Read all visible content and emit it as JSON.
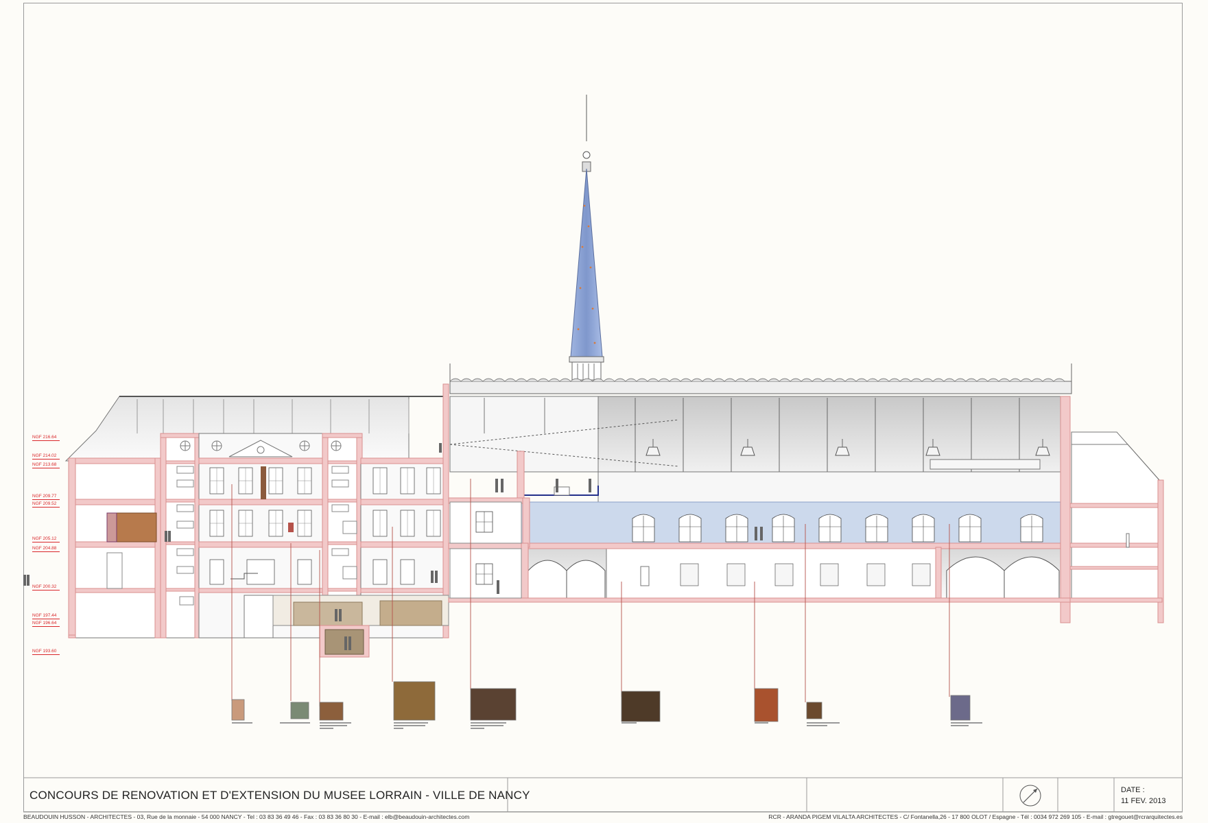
{
  "title_block": {
    "project_title": "CONCOURS DE RENOVATION ET D'EXTENSION DU MUSEE LORRAIN - VILLE DE NANCY",
    "date_label": "DATE :",
    "date_value": "11 FEV. 2013"
  },
  "footer": {
    "left": "BEAUDOUIN HUSSON - ARCHITECTES - 03, Rue de la monnaie - 54 000  NANCY - Tel : 03 83 36 49 46 - Fax : 03 83 36 80 30 - E-mail : elb@beaudouin-architectes.com",
    "right": "RCR - ARANDA PIGEM VILALTA ARCHITECTES - C/ Fontanella,26 - 17 800 OLOT / Espagne - Tél : 0034 972 269 105 - E-mail : gtregouet@rcrarquitectes.es"
  },
  "levels": [
    "NGF 216.64",
    "NGF 214.02",
    "NGF 213.68",
    "NGF 209.77",
    "NGF 209.52",
    "NGF 205.12",
    "NGF 204.88",
    "NGF 200.32",
    "NGF 197.44",
    "NGF 196.64",
    "NGF 193.60"
  ],
  "colors": {
    "wall": "#f2c9c9",
    "wall_outline": "#d9908f",
    "level_red": "#d9262a",
    "gallery_blue": "#ccd9ec",
    "spire_blue": "#8ea3d4",
    "leader": "#b5524a"
  },
  "icons": [
    "north-arrow-icon"
  ]
}
